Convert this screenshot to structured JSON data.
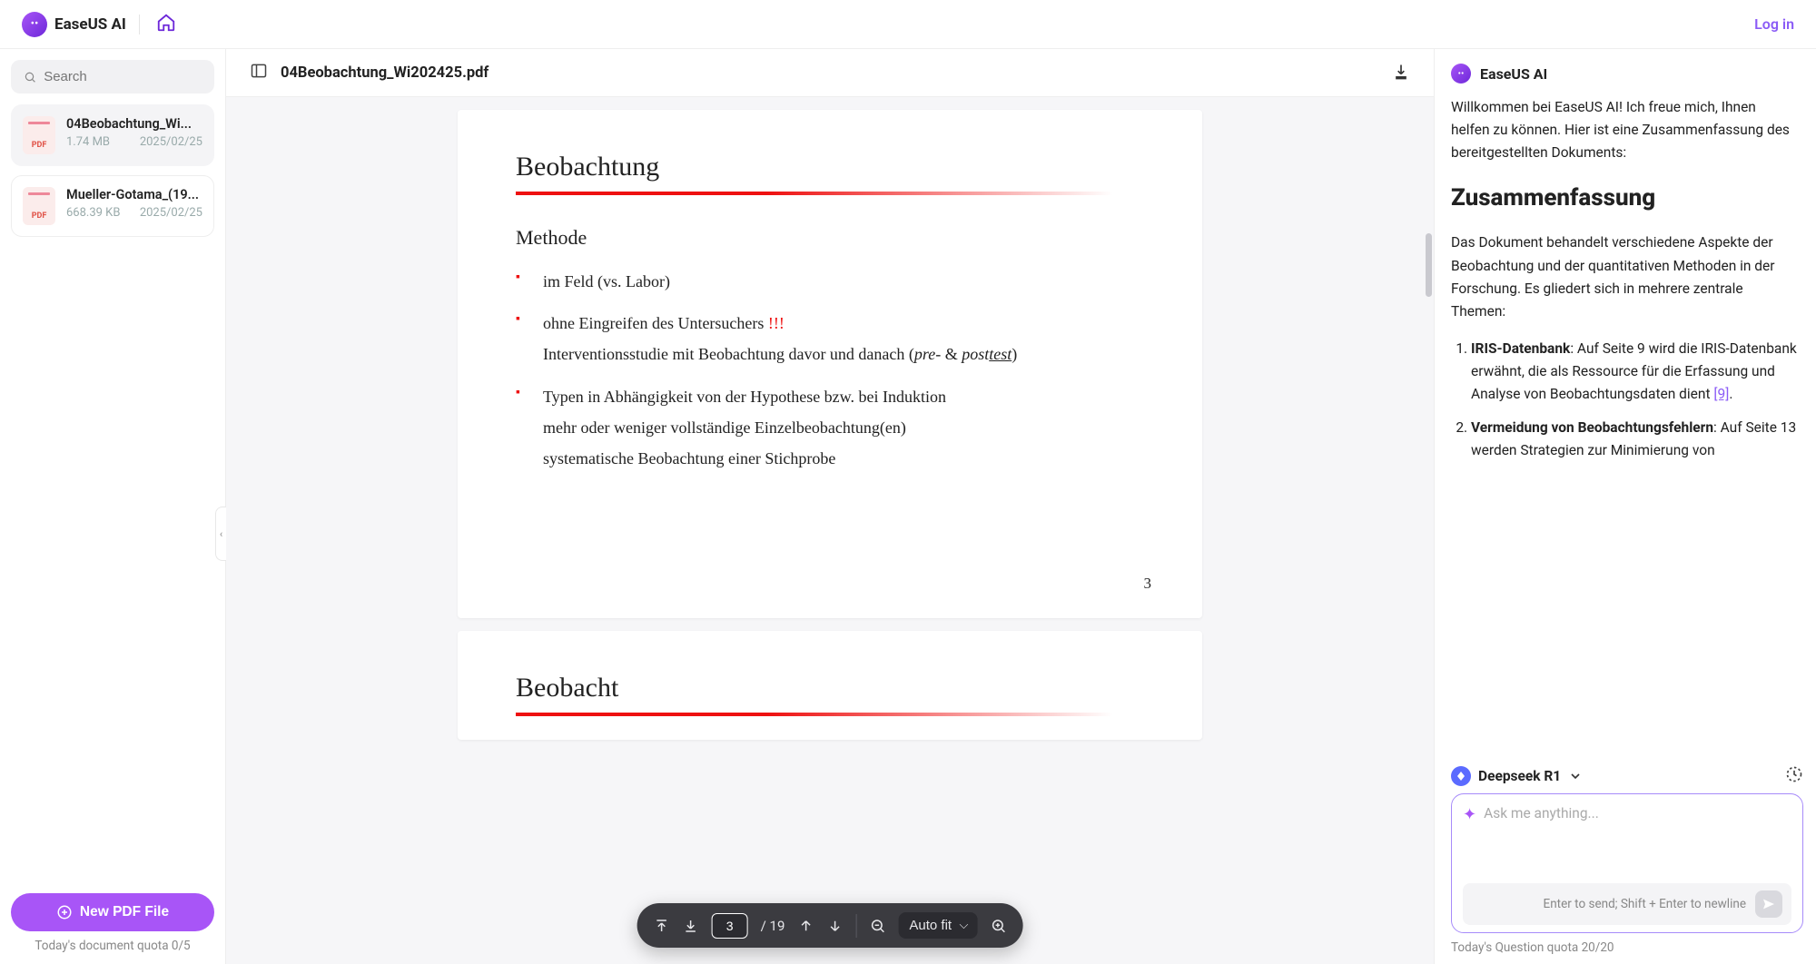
{
  "header": {
    "app_name": "EaseUS AI",
    "login": "Log in"
  },
  "sidebar": {
    "search_placeholder": "Search",
    "files": [
      {
        "name": "04Beobachtung_Wi...",
        "size": "1.74 MB",
        "date": "2025/02/25",
        "active": true
      },
      {
        "name": "Mueller-Gotama_(19...",
        "size": "668.39 KB",
        "date": "2025/02/25",
        "active": false
      }
    ],
    "new_pdf": "New PDF File",
    "quota": "Today's document quota 0/5"
  },
  "doc": {
    "title": "04Beobachtung_Wi202425.pdf",
    "page_heading": "Beobachtung",
    "section": "Methode",
    "bullets": {
      "b1": "im Feld (vs. Labor)",
      "b2a": "ohne Eingreifen des Untersuchers ",
      "b2b": "!!!",
      "b2sub_a": "Interventionsstudie mit Beobachtung davor und danach (",
      "b2sub_b": "pre",
      "b2sub_c": "- & ",
      "b2sub_d": "post",
      "b2sub_e": "test",
      "b2sub_f": ")",
      "b3": "Typen in Abhängigkeit von der Hypothese bzw. bei Induktion",
      "b3s1": "mehr oder weniger vollständige Einzelbeobachtung(en)",
      "b3s2": "systematische Beobachtung einer Stichprobe"
    },
    "page_number": "3",
    "next_heading": "Beobacht"
  },
  "toolbar": {
    "page_current": "3",
    "page_total": "/ 19",
    "zoom": "Auto fit"
  },
  "chat": {
    "title": "EaseUS AI",
    "intro": "Willkommen bei EaseUS AI! Ich freue mich, Ihnen helfen zu können. Hier ist eine Zusammenfassung des bereitgestellten Dokuments:",
    "summary_h": "Zusammenfassung",
    "summary_p": "Das Dokument behandelt verschiedene Aspekte der Beobachtung und der quantitativen Methoden in der Forschung. Es gliedert sich in mehrere zentrale Themen:",
    "li1_strong": "IRIS-Datenbank",
    "li1_rest": ": Auf Seite 9 wird die IRIS-Datenbank erwähnt, die als Ressource für die Erfassung und Analyse von Beobachtungsdaten dient ",
    "li1_ref": "[9]",
    "li1_end": ".",
    "li2_strong": "Vermeidung von Beobachtungsfehlern",
    "li2_rest": ": Auf Seite 13 werden Strategien zur Minimierung von",
    "model": "Deepseek R1",
    "input_placeholder": "Ask me anything...",
    "hint": "Enter to send; Shift + Enter to newline",
    "quota": "Today's Question quota 20/20"
  }
}
